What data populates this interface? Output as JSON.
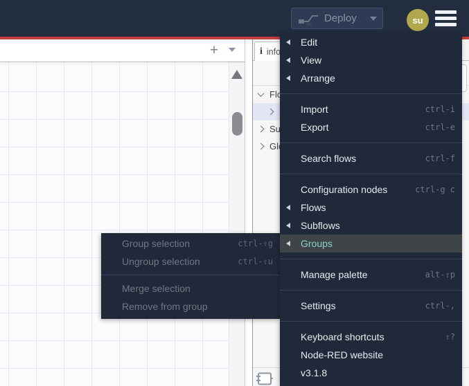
{
  "header": {
    "deploy_label": "Deploy",
    "avatar_initials": "su"
  },
  "flow_tabbar": {
    "add_flow_icon": "+"
  },
  "sidebar": {
    "info_tab_icon": "i",
    "info_tab_label": "info",
    "tree": [
      {
        "label": "Flows"
      },
      {
        "label": ""
      },
      {
        "label": "Subflows"
      },
      {
        "label": "Global Configuration Nodes"
      }
    ]
  },
  "menu": {
    "items": [
      {
        "label": "Edit"
      },
      {
        "label": "View"
      },
      {
        "label": "Arrange"
      },
      {
        "label": "Import",
        "shortcut": "ctrl-i"
      },
      {
        "label": "Export",
        "shortcut": "ctrl-e"
      },
      {
        "label": "Search flows",
        "shortcut": "ctrl-f"
      },
      {
        "label": "Configuration nodes",
        "shortcut": "ctrl-g c"
      },
      {
        "label": "Flows"
      },
      {
        "label": "Subflows"
      },
      {
        "label": "Groups"
      },
      {
        "label": "Manage palette",
        "shortcut": "alt-⇧p"
      },
      {
        "label": "Settings",
        "shortcut": "ctrl-,"
      },
      {
        "label": "Keyboard shortcuts",
        "shortcut": "⇧?"
      },
      {
        "label": "Node-RED website"
      },
      {
        "label": "v3.1.8"
      }
    ]
  },
  "groups_submenu": {
    "items": [
      {
        "label": "Group selection",
        "shortcut": "ctrl-⇧g"
      },
      {
        "label": "Ungroup selection",
        "shortcut": "ctrl-⇧u"
      },
      {
        "label": "Merge selection"
      },
      {
        "label": "Remove from group"
      }
    ]
  },
  "colors": {
    "header_bg": "#232d40",
    "menu_bg": "#1f2939",
    "menu_hover_bg": "#3f4449",
    "menu_hover_text": "#8ad2c4",
    "accent_red": "#c43c3c",
    "avatar_bg": "#b1a74c",
    "selected_row_bg": "#e3e6f4"
  }
}
